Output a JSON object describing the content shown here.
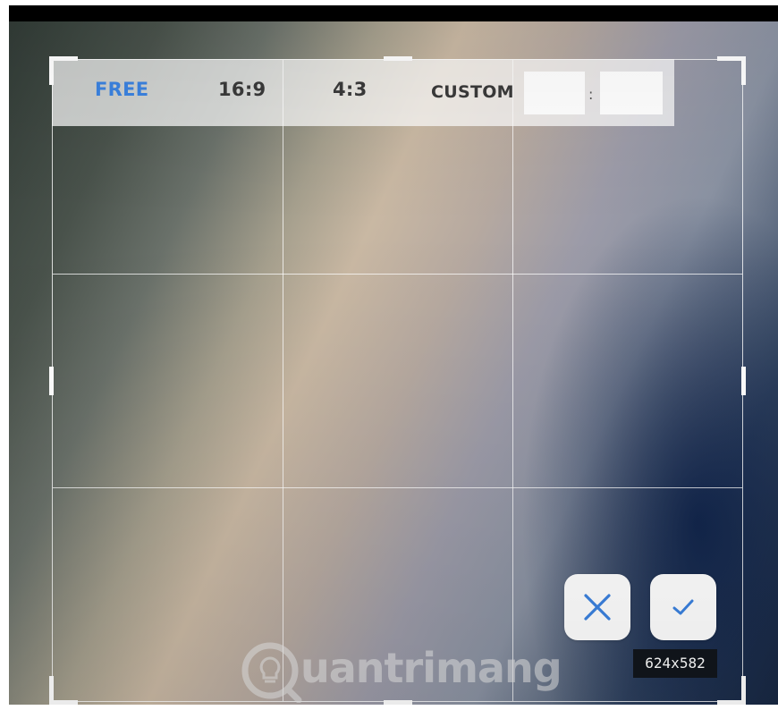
{
  "crop_toolbar": {
    "options": [
      {
        "id": "free",
        "label": "FREE",
        "selected": true
      },
      {
        "id": "16-9",
        "label": "16:9",
        "selected": false
      },
      {
        "id": "4-3",
        "label": "4:3",
        "selected": false
      },
      {
        "id": "custom",
        "label": "CUSTOM",
        "selected": false
      }
    ],
    "custom_width_value": "",
    "custom_height_value": "",
    "custom_separator": ":"
  },
  "actions": {
    "cancel_icon": "close-icon",
    "confirm_icon": "checkmark-icon"
  },
  "size_label": "624x582",
  "watermark": {
    "text": "uantrimang",
    "icon": "lightbulb-logo-icon"
  },
  "colors": {
    "accent": "#3b82e0",
    "size_label_bg": "#11161c",
    "toolbar_text": "#3a3a3a"
  }
}
